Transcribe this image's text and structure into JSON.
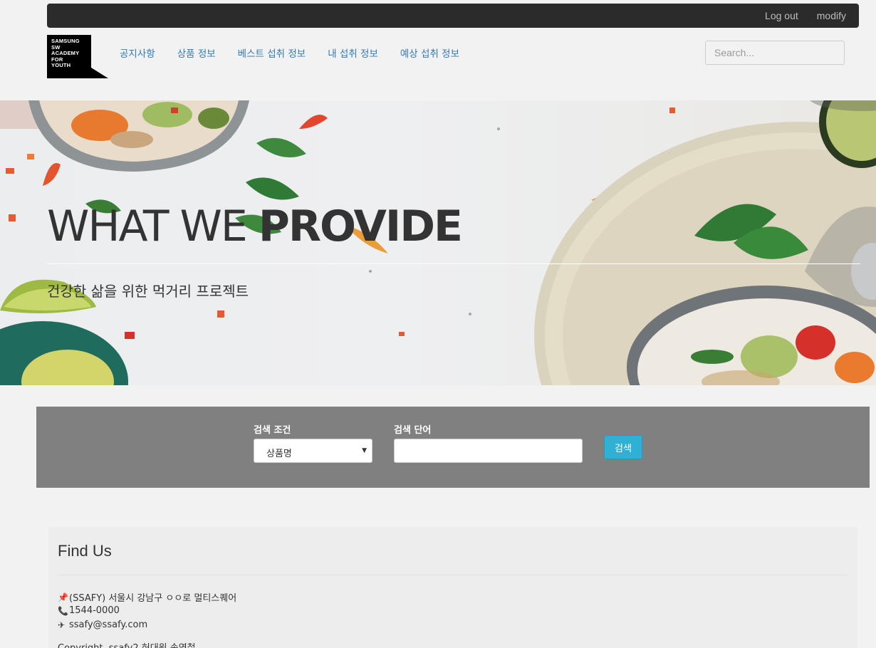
{
  "topbar": {
    "logout": "Log out",
    "modify": "modify"
  },
  "logo": {
    "lines": [
      "SAMSUNG",
      "SW",
      "ACADEMY",
      "FOR",
      "YOUTH"
    ]
  },
  "nav": {
    "items": [
      "공지사항",
      "상품 정보",
      "베스트 섭취 정보",
      "내 섭취 정보",
      "예상 섭취 정보"
    ]
  },
  "search": {
    "placeholder": "Search..."
  },
  "hero": {
    "title_light": "WHAT WE ",
    "title_bold": "PROVIDE",
    "subtitle": "건강한 삶을 위한 먹거리 프로젝트"
  },
  "filter": {
    "condition_label": "검색 조건",
    "condition_value": "상품명",
    "word_label": "검색 단어",
    "word_value": "",
    "button": "검색"
  },
  "footer": {
    "title": "Find Us",
    "address": "(SSAFY) 서울시 강남구 ㅇㅇ로 멀티스퀘어",
    "phone": "1544-0000",
    "email": "ssafy@ssafy.com",
    "copyright": "Copyright. ssafy2 허대원 송영철"
  },
  "colors": {
    "link": "#337ab7",
    "topbar": "#2b2b2b",
    "filter_bg": "#808080",
    "button": "#31b0d5"
  },
  "icons": [
    "pin-icon",
    "phone-icon",
    "paper-plane-icon",
    "dropdown-arrow-icon"
  ]
}
